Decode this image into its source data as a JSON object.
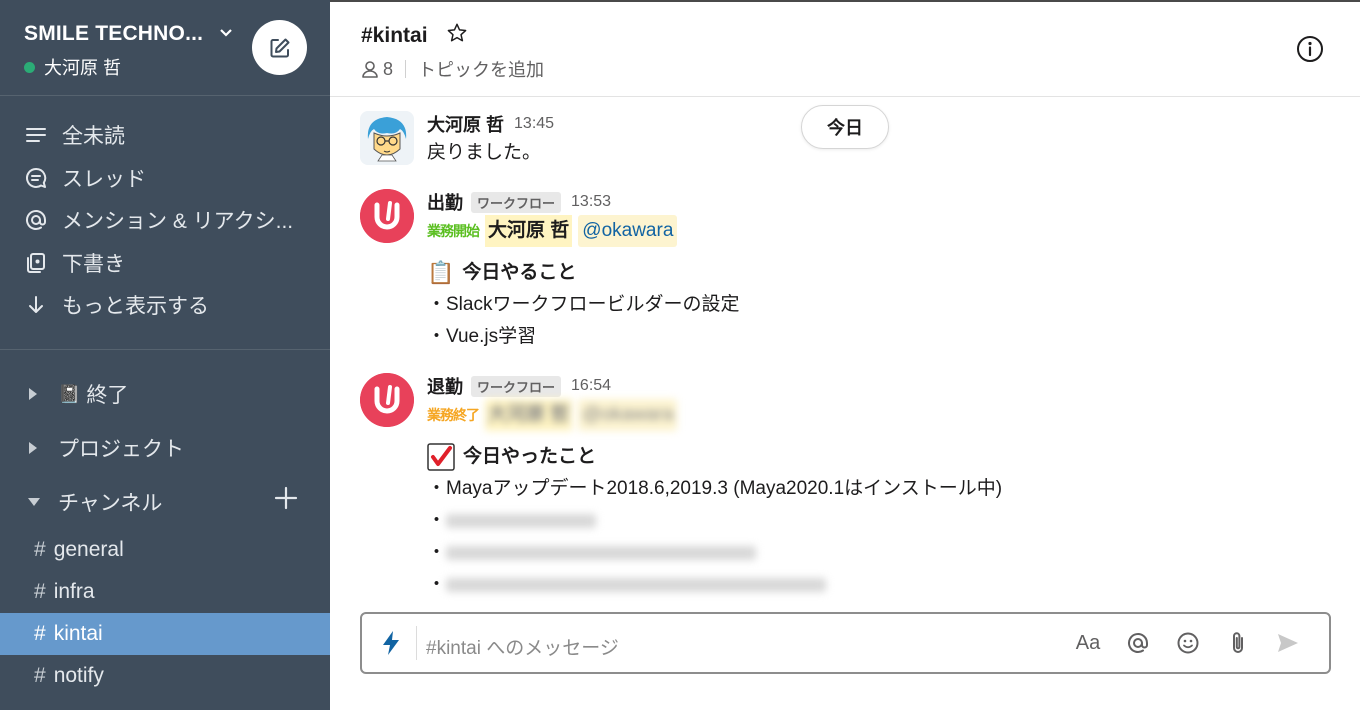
{
  "workspace": {
    "name": "SMILE TECHNO...",
    "user": "大河原 哲"
  },
  "nav": [
    {
      "icon": "all-unreads-icon",
      "label": "全未読"
    },
    {
      "icon": "threads-icon",
      "label": "スレッド"
    },
    {
      "icon": "mention-icon",
      "label": "メンション & リアクシ..."
    },
    {
      "icon": "drafts-icon",
      "label": "下書き"
    },
    {
      "icon": "arrow-down-icon",
      "label": "もっと表示する"
    }
  ],
  "sections": [
    {
      "label": "終了",
      "emoji": "📓"
    },
    {
      "label": "プロジェクト"
    },
    {
      "label": "チャンネル"
    }
  ],
  "channels": [
    {
      "name": "general"
    },
    {
      "name": "infra"
    },
    {
      "name": "kintai",
      "active": true
    },
    {
      "name": "notify"
    }
  ],
  "channel": {
    "title": "#kintai",
    "members": "8",
    "topic": "トピックを追加"
  },
  "today_label": "今日",
  "messages": [
    {
      "name": "大河原 哲",
      "time": "13:45",
      "text": "戻りました。"
    },
    {
      "name": "出勤",
      "tag": "ワークフロー",
      "time": "13:53",
      "badge": "業務開始",
      "user": "大河原 哲",
      "mention": "@okawara",
      "emoji": "📋",
      "heading": "今日やること",
      "items": [
        "・Slackワークフロービルダーの設定",
        "・Vue.js学習"
      ]
    },
    {
      "name": "退勤",
      "tag": "ワークフロー",
      "time": "16:54",
      "badge": "業務終了",
      "user": "大河原 哲",
      "mention": "@okawara",
      "emoji": "✔",
      "heading": "今日やったこと",
      "items": [
        "・Mayaアップデート2018.6,2019.3 (Maya2020.1はインストール中)",
        "・",
        "・",
        "・"
      ]
    }
  ],
  "composer": {
    "placeholder": "#kintai へのメッセージ",
    "format_label": "Aa"
  },
  "colors": {
    "sidebar": "#3f4d5c",
    "active_channel": "#6699cc",
    "presence": "#2bac76",
    "app_avatar": "#e8415a"
  }
}
